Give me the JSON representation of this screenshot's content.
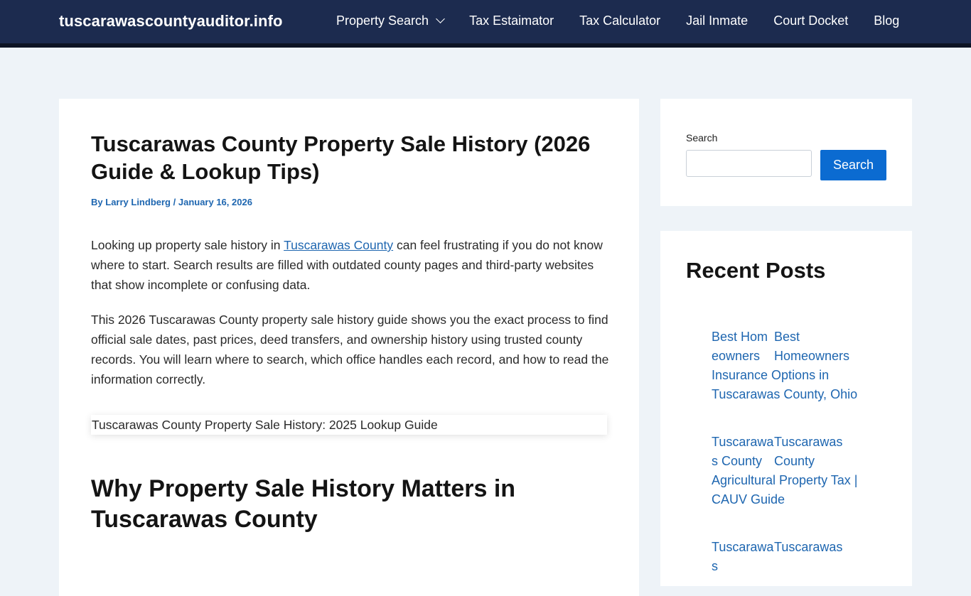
{
  "header": {
    "site_title": "tuscarawascountyauditor.info",
    "nav": [
      {
        "label": "Property Search"
      },
      {
        "label": "Tax Estaimator"
      },
      {
        "label": "Tax Calculator"
      },
      {
        "label": "Jail Inmate"
      },
      {
        "label": "Court Docket"
      },
      {
        "label": "Blog"
      }
    ]
  },
  "article": {
    "title": "Tuscarawas County Property Sale History (2026 Guide & Lookup Tips)",
    "meta": {
      "by": "By",
      "author": "Larry Lindberg",
      "separator": "/",
      "date": "January 16, 2026"
    },
    "p1_before": "Looking up property sale history in ",
    "p1_link": "Tuscarawas County",
    "p1_after": " can feel frustrating if you do not know where to start. Search results are filled with outdated county pages and third-party websites that show incomplete or confusing data.",
    "p2": "This 2026 Tuscarawas County property sale history guide shows you the exact process to find official sale dates, past prices, deed transfers, and ownership history using trusted county records. You will learn where to search, which office handles each record, and how to read the information correctly.",
    "image_alt": "Tuscarawas County Property Sale History: 2025 Lookup Guide",
    "h2": "Why Property Sale History Matters in Tuscarawas County"
  },
  "sidebar": {
    "search": {
      "label": "Search",
      "input_value": "",
      "button_label": "Search"
    },
    "recent_posts": {
      "heading": "Recent Posts",
      "posts": [
        {
          "thumb_alt": "Best Homeowners",
          "title": "Best Homeowners Insurance Options in Tuscarawas County, Ohio"
        },
        {
          "thumb_alt": "Tuscarawas County",
          "title": "Tuscarawas County Agricultural Property Tax | CAUV Guide"
        },
        {
          "thumb_alt": "Tuscarawas",
          "title": "Tuscarawas"
        }
      ]
    }
  }
}
